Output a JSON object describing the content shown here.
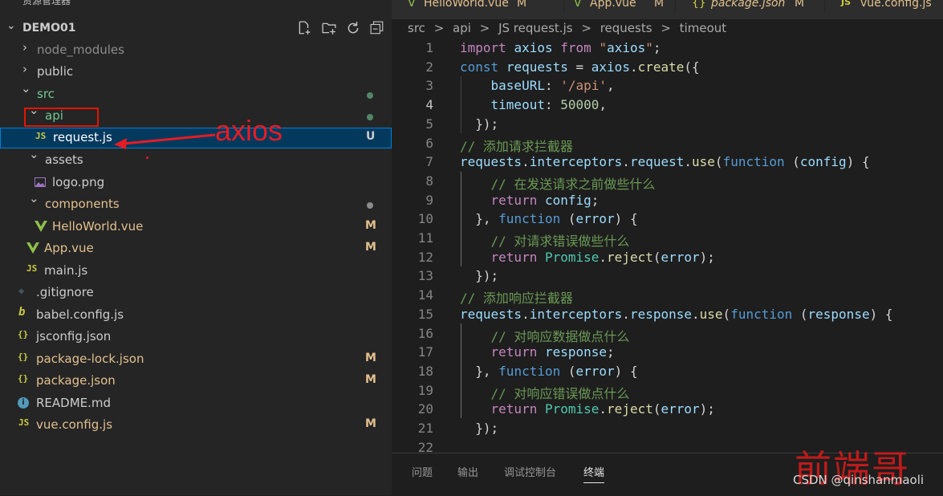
{
  "sidebar": {
    "header_title": "资源管理器",
    "header_more": "···",
    "project_name": "DEMO01",
    "project_actions": [
      "new-file-icon",
      "new-folder-icon",
      "refresh-icon",
      "collapse-all-icon"
    ],
    "items": [
      {
        "label": "node_modules",
        "chevron": "›",
        "color": "#8c8c8c",
        "badge": ""
      },
      {
        "label": "public",
        "chevron": "›",
        "color": "#cccccc",
        "badge": ""
      },
      {
        "label": "src",
        "chevron": "⌄",
        "color": "#73c991",
        "badge": ""
      },
      {
        "label": "api",
        "chevron": "⌄",
        "color": "#73c991",
        "badge": ""
      },
      {
        "label": "request.js",
        "icon": "JS",
        "color": "#cccccc",
        "badge": "U"
      },
      {
        "label": "assets",
        "chevron": "⌄",
        "color": "#cccccc",
        "badge": ""
      },
      {
        "label": "logo.png",
        "icon": "img",
        "color": "#cccccc",
        "badge": ""
      },
      {
        "label": "components",
        "chevron": "⌄",
        "color": "#e2c08d",
        "badge": ""
      },
      {
        "label": "HelloWorld.vue",
        "icon": "V",
        "color": "#e2c08d",
        "badge": "M"
      },
      {
        "label": "App.vue",
        "icon": "V",
        "color": "#e2c08d",
        "badge": "M"
      },
      {
        "label": "main.js",
        "icon": "JS",
        "color": "#cccccc",
        "badge": ""
      },
      {
        "label": ".gitignore",
        "icon": "◆",
        "color": "#cccccc",
        "badge": ""
      },
      {
        "label": "babel.config.js",
        "icon": "b",
        "color": "#cccccc",
        "badge": ""
      },
      {
        "label": "jsconfig.json",
        "icon": "{}",
        "color": "#cccccc",
        "badge": ""
      },
      {
        "label": "package-lock.json",
        "icon": "{}",
        "color": "#e2c08d",
        "badge": "M"
      },
      {
        "label": "package.json",
        "icon": "{}",
        "color": "#e2c08d",
        "badge": "M"
      },
      {
        "label": "README.md",
        "icon": "i",
        "color": "#cccccc",
        "badge": ""
      },
      {
        "label": "vue.config.js",
        "icon": "JS",
        "color": "#e2c08d",
        "badge": "M"
      }
    ]
  },
  "annotation": {
    "text": "axios"
  },
  "tabs": [
    {
      "label": "HelloWorld.vue",
      "badge": "M",
      "icon": "V"
    },
    {
      "label": "App.vue",
      "badge": "M",
      "icon": "V"
    },
    {
      "label": "package.json",
      "badge": "M",
      "icon": "{}"
    },
    {
      "label": "vue.config.js",
      "badge": "",
      "icon": "JS"
    }
  ],
  "breadcrumbs": [
    "src",
    ">",
    "api",
    ">",
    "JS request.js",
    ">",
    "requests",
    ">",
    "timeout"
  ],
  "editor": {
    "current_line": 4,
    "lines": [
      "import axios from \"axios\";",
      "const requests = axios.create({",
      "    baseURL: '/api',",
      "    timeout: 50000,",
      "  });",
      "// 添加请求拦截器",
      "requests.interceptors.request.use(function (config) {",
      "    // 在发送请求之前做些什么",
      "    return config;",
      "  }, function (error) {",
      "    // 对请求错误做些什么",
      "    return Promise.reject(error);",
      "  });",
      "// 添加响应拦截器",
      "requests.interceptors.response.use(function (response) {",
      "    // 对响应数据做点什么",
      "    return response;",
      "  }, function (error) {",
      "    // 对响应错误做点什么",
      "    return Promise.reject(error);",
      "  });",
      ""
    ]
  },
  "panel": {
    "tabs": [
      "问题",
      "输出",
      "调试控制台",
      "终端"
    ],
    "active": "终端"
  },
  "watermark": {
    "cn": "前端哥",
    "csdn": "CSDN @qinshanmaoli"
  },
  "colors": {
    "accent": "#007fd4",
    "modified": "#e2c08d",
    "untracked": "#73c991",
    "annotation": "#e51c23"
  }
}
